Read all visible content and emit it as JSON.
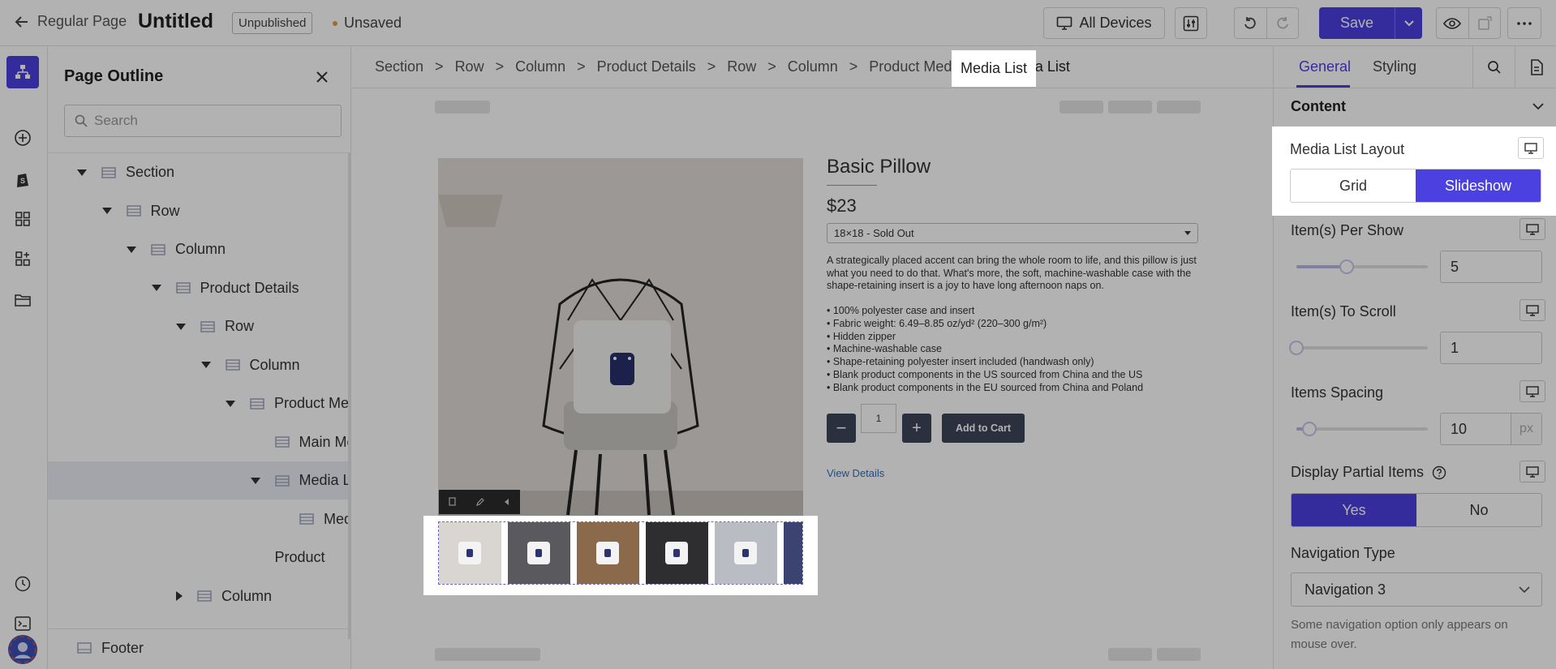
{
  "topbar": {
    "back_label": "Regular Page",
    "title": "Untitled",
    "status": "Unpublished",
    "save_state": "Unsaved",
    "devices_label": "All Devices",
    "save_label": "Save",
    "colors": {
      "accent": "#4b40e0",
      "unsaved_dot": "#e0a043"
    }
  },
  "rail": {
    "icons": [
      "outline-icon",
      "add-icon",
      "shopify-icon",
      "components-icon",
      "apps-icon",
      "folder-icon",
      "history-icon",
      "code-icon",
      "avatar"
    ]
  },
  "outline": {
    "title": "Page Outline",
    "search_placeholder": "Search",
    "nodes": [
      {
        "label": "Section",
        "level": 0,
        "caret": "down"
      },
      {
        "label": "Row",
        "level": 1,
        "caret": "down"
      },
      {
        "label": "Column",
        "level": 2,
        "caret": "down"
      },
      {
        "label": "Product Details",
        "level": 3,
        "caret": "down"
      },
      {
        "label": "Row",
        "level": 4,
        "caret": "down"
      },
      {
        "label": "Column",
        "level": 5,
        "caret": "down"
      },
      {
        "label": "Product Med",
        "level": 6,
        "caret": "down"
      },
      {
        "label": "Main Me",
        "level": 7,
        "caret": "none"
      },
      {
        "label": "Media L",
        "level": 7,
        "caret": "down",
        "selected": true
      },
      {
        "label": "Med",
        "level": 8,
        "caret": "none"
      },
      {
        "label": "Product",
        "level": 7,
        "caret": "none",
        "noicon": true
      },
      {
        "label": "Column",
        "level": 4,
        "caret": "right"
      }
    ],
    "footer_label": "Footer"
  },
  "breadcrumb": [
    "Section",
    "Row",
    "Column",
    "Product Details",
    "Row",
    "Column",
    "Product Media",
    "Media List"
  ],
  "product": {
    "title": "Basic Pillow",
    "price": "$23",
    "variant": "18×18 - Sold Out",
    "description": "A strategically placed accent can bring the whole room to life, and this pillow is just what you need to do that. What's more, the soft, machine-washable case with the shape-retaining insert is a joy to have long afternoon naps on.",
    "bullets": [
      "• 100% polyester case and insert",
      "• Fabric weight: 6.49–8.85 oz/yd² (220–300 g/m²)",
      "• Hidden zipper",
      "• Machine-washable case",
      "• Shape-retaining polyester insert included (handwash only)",
      "• Blank product components in the US sourced from China and the US",
      "• Blank product components in the EU sourced from China and Poland"
    ],
    "quantity": "1",
    "minus_label": "−",
    "plus_label": "+",
    "add_to_cart": "Add to Cart",
    "view_details": "View Details",
    "thumb_count": 6
  },
  "rpanel": {
    "tabs": {
      "general": "General",
      "styling": "Styling"
    },
    "content_label": "Content",
    "layout": {
      "label": "Media List Layout",
      "options": [
        "Grid",
        "Slideshow"
      ],
      "selected": "Slideshow"
    },
    "per_show": {
      "label": "Item(s) Per Show",
      "value": "5",
      "slider_fraction": 0.38
    },
    "to_scroll": {
      "label": "Item(s) To Scroll",
      "value": "1",
      "slider_fraction": 0.0
    },
    "spacing": {
      "label": "Items Spacing",
      "value": "10",
      "unit": "px",
      "slider_fraction": 0.1
    },
    "partial": {
      "label": "Display Partial Items",
      "options": [
        "Yes",
        "No"
      ],
      "selected": "Yes"
    },
    "nav_type": {
      "label": "Navigation Type",
      "value": "Navigation 3",
      "note": "Some navigation option only appears on mouse over."
    }
  }
}
